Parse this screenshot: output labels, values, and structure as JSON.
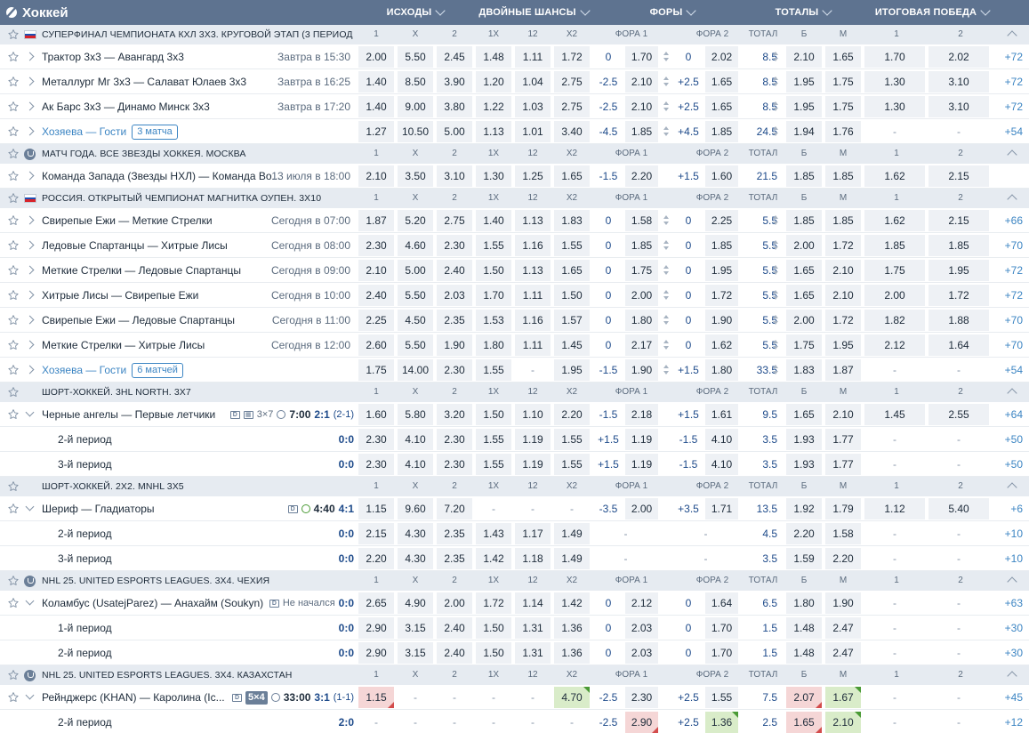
{
  "header": {
    "title": "Хоккей",
    "columns": [
      "ИСХОДЫ",
      "ДВОЙНЫЕ ШАНСЫ",
      "ФОРЫ",
      "ТОТАЛЫ",
      "ИТОГОВАЯ ПОБЕДА"
    ]
  },
  "market_labels": [
    "1",
    "X",
    "2",
    "1X",
    "12",
    "X2",
    "ФОРА 1",
    "ФОРА 2",
    "ТОТАЛ",
    "Б",
    "М",
    "1",
    "2"
  ],
  "rows": [
    {
      "type": "group",
      "flag": "ru",
      "name": "СУПЕРФИНАЛ ЧЕМПИОНАТА КХЛ 3Х3. КРУГОВОЙ ЭТАП (3 ПЕРИОД..."
    },
    {
      "type": "event",
      "name": "Трактор 3х3 — Авангард 3х3",
      "time": "Завтра в 15:30",
      "odds": [
        "2.00",
        "5.50",
        "2.45",
        "1.48",
        "1.11",
        "1.72"
      ],
      "h1": "0",
      "h1o": "1.70",
      "h2": "0",
      "h2o": "2.02",
      "total": "8.5",
      "ov": "2.10",
      "un": "1.65",
      "w1": "1.70",
      "w2": "2.02",
      "more": "+72",
      "spin": true
    },
    {
      "type": "event",
      "name": "Металлург Мг 3х3 — Салават Юлаев 3х3",
      "time": "Завтра в 16:25",
      "odds": [
        "1.40",
        "8.50",
        "3.90",
        "1.20",
        "1.04",
        "2.75"
      ],
      "h1": "-2.5",
      "h1o": "2.10",
      "h2": "+2.5",
      "h2o": "1.65",
      "total": "8.5",
      "ov": "1.95",
      "un": "1.75",
      "w1": "1.30",
      "w2": "3.10",
      "more": "+72",
      "spin": true
    },
    {
      "type": "event",
      "name": "Ак Барс 3х3 — Динамо Минск 3х3",
      "time": "Завтра в 17:20",
      "odds": [
        "1.40",
        "9.00",
        "3.80",
        "1.22",
        "1.03",
        "2.75"
      ],
      "h1": "-2.5",
      "h1o": "2.10",
      "h2": "+2.5",
      "h2o": "1.65",
      "total": "8.5",
      "ov": "1.95",
      "un": "1.75",
      "w1": "1.30",
      "w2": "3.10",
      "more": "+72",
      "spin": true
    },
    {
      "type": "event",
      "name": "Хозяева — Гости",
      "link": true,
      "badge": "3 матча",
      "odds": [
        "1.27",
        "10.50",
        "5.00",
        "1.13",
        "1.01",
        "3.40"
      ],
      "h1": "-4.5",
      "h1o": "1.85",
      "h2": "+4.5",
      "h2o": "1.85",
      "total": "24.5",
      "ov": "1.94",
      "un": "1.76",
      "w1": "-",
      "w2": "-",
      "more": "+54",
      "spin": true
    },
    {
      "type": "group",
      "flag": "cup",
      "name": "МАТЧ ГОДА. ВСЕ ЗВЕЗДЫ ХОККЕЯ. МОСКВА"
    },
    {
      "type": "event",
      "name": "Команда Запада (Звезды НХЛ) — Команда Во...",
      "time": "13 июля в 18:00",
      "odds": [
        "2.10",
        "3.50",
        "3.10",
        "1.30",
        "1.25",
        "1.65"
      ],
      "h1": "-1.5",
      "h1o": "2.20",
      "h2": "+1.5",
      "h2o": "1.60",
      "total": "21.5",
      "ov": "1.85",
      "un": "1.85",
      "w1": "1.62",
      "w2": "2.15",
      "more": ""
    },
    {
      "type": "group",
      "flag": "ru",
      "name": "РОССИЯ. ОТКРЫТЫЙ ЧЕМПИОНАТ МАГНИТКА ОУПЕН. 3Х10"
    },
    {
      "type": "event",
      "name": "Свирепые Ежи — Меткие Стрелки",
      "time": "Сегодня в 07:00",
      "odds": [
        "1.87",
        "5.20",
        "2.75",
        "1.40",
        "1.13",
        "1.83"
      ],
      "h1": "0",
      "h1o": "1.58",
      "h2": "0",
      "h2o": "2.25",
      "total": "5.5",
      "ov": "1.85",
      "un": "1.85",
      "w1": "1.62",
      "w2": "2.15",
      "more": "+66",
      "spin": true
    },
    {
      "type": "event",
      "name": "Ледовые Спартанцы — Хитрые Лисы",
      "time": "Сегодня в 08:00",
      "odds": [
        "2.30",
        "4.60",
        "2.30",
        "1.55",
        "1.16",
        "1.55"
      ],
      "h1": "0",
      "h1o": "1.85",
      "h2": "0",
      "h2o": "1.85",
      "total": "5.5",
      "ov": "2.00",
      "un": "1.72",
      "w1": "1.85",
      "w2": "1.85",
      "more": "+70",
      "spin": true
    },
    {
      "type": "event",
      "name": "Меткие Стрелки — Ледовые Спартанцы",
      "time": "Сегодня в 09:00",
      "odds": [
        "2.10",
        "5.00",
        "2.40",
        "1.50",
        "1.13",
        "1.65"
      ],
      "h1": "0",
      "h1o": "1.75",
      "h2": "0",
      "h2o": "1.95",
      "total": "5.5",
      "ov": "1.65",
      "un": "2.10",
      "w1": "1.75",
      "w2": "1.95",
      "more": "+72",
      "spin": true
    },
    {
      "type": "event",
      "name": "Хитрые Лисы — Свирепые Ежи",
      "time": "Сегодня в 10:00",
      "odds": [
        "2.40",
        "5.50",
        "2.03",
        "1.70",
        "1.11",
        "1.50"
      ],
      "h1": "0",
      "h1o": "2.00",
      "h2": "0",
      "h2o": "1.72",
      "total": "5.5",
      "ov": "1.65",
      "un": "2.10",
      "w1": "2.00",
      "w2": "1.72",
      "more": "+72",
      "spin": true
    },
    {
      "type": "event",
      "name": "Свирепые Ежи — Ледовые Спартанцы",
      "time": "Сегодня в 11:00",
      "odds": [
        "2.25",
        "4.50",
        "2.35",
        "1.53",
        "1.16",
        "1.57"
      ],
      "h1": "0",
      "h1o": "1.80",
      "h2": "0",
      "h2o": "1.90",
      "total": "5.5",
      "ov": "2.00",
      "un": "1.72",
      "w1": "1.82",
      "w2": "1.88",
      "more": "+70",
      "spin": true
    },
    {
      "type": "event",
      "name": "Меткие Стрелки — Хитрые Лисы",
      "time": "Сегодня в 12:00",
      "odds": [
        "2.60",
        "5.50",
        "1.90",
        "1.80",
        "1.11",
        "1.45"
      ],
      "h1": "0",
      "h1o": "2.17",
      "h2": "0",
      "h2o": "1.62",
      "total": "5.5",
      "ov": "1.75",
      "un": "1.95",
      "w1": "2.12",
      "w2": "1.64",
      "more": "+70",
      "spin": true
    },
    {
      "type": "event",
      "name": "Хозяева — Гости",
      "link": true,
      "badge": "6 матчей",
      "odds": [
        "1.75",
        "14.00",
        "2.30",
        "1.55",
        "-",
        "1.95"
      ],
      "h1": "-1.5",
      "h1o": "1.90",
      "h2": "+1.5",
      "h2o": "1.80",
      "total": "33.5",
      "ov": "1.83",
      "un": "1.87",
      "w1": "-",
      "w2": "-",
      "more": "+54",
      "spin": true
    },
    {
      "type": "group",
      "flag": "none",
      "name": "ШОРТ-ХОККЕЙ. 3HL NORTH. 3X7"
    },
    {
      "type": "live",
      "name": "Черные ангелы — Первые летчики",
      "fmt": "3×7",
      "clock": "7:00",
      "score": "2:1",
      "sub": "(2-1)",
      "icons": [
        "D",
        "▦"
      ],
      "odds": [
        "1.60",
        "5.80",
        "3.20",
        "1.50",
        "1.10",
        "2.20"
      ],
      "h1": "-1.5",
      "h1o": "2.18",
      "h2": "+1.5",
      "h2o": "1.61",
      "total": "9.5",
      "ov": "1.65",
      "un": "2.10",
      "w1": "1.45",
      "w2": "2.55",
      "more": "+64"
    },
    {
      "type": "sub",
      "name": "2-й период",
      "score": "0:0",
      "odds": [
        "2.30",
        "4.10",
        "2.30",
        "1.55",
        "1.19",
        "1.55"
      ],
      "h1": "+1.5",
      "h1o": "1.19",
      "h2": "-1.5",
      "h2o": "4.10",
      "total": "3.5",
      "ov": "1.93",
      "un": "1.77",
      "w1": "-",
      "w2": "-",
      "more": "+50"
    },
    {
      "type": "sub",
      "name": "3-й период",
      "score": "0:0",
      "odds": [
        "2.30",
        "4.10",
        "2.30",
        "1.55",
        "1.19",
        "1.55"
      ],
      "h1": "+1.5",
      "h1o": "1.19",
      "h2": "-1.5",
      "h2o": "4.10",
      "total": "3.5",
      "ov": "1.93",
      "un": "1.77",
      "w1": "-",
      "w2": "-",
      "more": "+50"
    },
    {
      "type": "group",
      "flag": "none",
      "name": "ШОРТ-ХОККЕЙ. 2X2. MNHL 3X5"
    },
    {
      "type": "live",
      "name": "Шериф — Гладиаторы",
      "clock": "4:40",
      "score": "4:1",
      "icons": [
        "D"
      ],
      "greenclock": true,
      "odds": [
        "1.15",
        "9.60",
        "7.20",
        "-",
        "-",
        "-"
      ],
      "h1": "-3.5",
      "h1o": "2.00",
      "h2": "+3.5",
      "h2o": "1.71",
      "total": "13.5",
      "ov": "1.92",
      "un": "1.79",
      "w1": "1.12",
      "w2": "5.40",
      "more": "+6"
    },
    {
      "type": "sub",
      "name": "2-й период",
      "score": "0:0",
      "odds": [
        "2.15",
        "4.30",
        "2.35",
        "1.43",
        "1.17",
        "1.49"
      ],
      "h1": "",
      "h1o": "-",
      "h2": "",
      "h2o": "-",
      "total": "4.5",
      "ov": "2.20",
      "un": "1.58",
      "w1": "-",
      "w2": "-",
      "more": "+10"
    },
    {
      "type": "sub",
      "name": "3-й период",
      "score": "0:0",
      "odds": [
        "2.20",
        "4.30",
        "2.35",
        "1.42",
        "1.18",
        "1.49"
      ],
      "h1": "",
      "h1o": "-",
      "h2": "",
      "h2o": "-",
      "total": "3.5",
      "ov": "1.59",
      "un": "2.20",
      "w1": "-",
      "w2": "-",
      "more": "+10"
    },
    {
      "type": "group",
      "flag": "cup",
      "name": "NHL 25. UNITED ESPORTS LEAGUES. 3Х4. ЧЕХИЯ"
    },
    {
      "type": "live",
      "name": "Коламбус (UsatejParez) — Анахайм (Soukyn)",
      "status": "Не начался",
      "score": "0:0",
      "icons": [
        "D"
      ],
      "odds": [
        "2.65",
        "4.90",
        "2.00",
        "1.72",
        "1.14",
        "1.42"
      ],
      "h1": "0",
      "h1o": "2.12",
      "h2": "0",
      "h2o": "1.64",
      "total": "6.5",
      "ov": "1.80",
      "un": "1.90",
      "w1": "-",
      "w2": "-",
      "more": "+63"
    },
    {
      "type": "sub",
      "name": "1-й период",
      "score": "0:0",
      "odds": [
        "2.90",
        "3.15",
        "2.40",
        "1.50",
        "1.31",
        "1.36"
      ],
      "h1": "0",
      "h1o": "2.03",
      "h2": "0",
      "h2o": "1.70",
      "total": "1.5",
      "ov": "1.48",
      "un": "2.47",
      "w1": "-",
      "w2": "-",
      "more": "+30"
    },
    {
      "type": "sub",
      "name": "2-й период",
      "score": "0:0",
      "odds": [
        "2.90",
        "3.15",
        "2.40",
        "1.50",
        "1.31",
        "1.36"
      ],
      "h1": "0",
      "h1o": "2.03",
      "h2": "0",
      "h2o": "1.70",
      "total": "1.5",
      "ov": "1.48",
      "un": "2.47",
      "w1": "-",
      "w2": "-",
      "more": "+30"
    },
    {
      "type": "group",
      "flag": "cup",
      "name": "NHL 25. UNITED ESPORTS LEAGUES. 3Х4. КАЗАХСТАН"
    },
    {
      "type": "live",
      "name": "Рейнджерс (KHAN) — Каролина (Ic...",
      "fmtBadge": "5×4",
      "clock": "33:00",
      "score": "3:1",
      "sub": "(1-1)",
      "icons": [
        "D"
      ],
      "odds": [
        "1.15",
        "-",
        "-",
        "-",
        "-",
        "4.70"
      ],
      "dn": [
        0
      ],
      "up": [
        5
      ],
      "h1": "-2.5",
      "h1o": "2.30",
      "h2": "+2.5",
      "h2o": "1.55",
      "total": "7.5",
      "ov": "2.07",
      "un": "1.67",
      "ovdn": true,
      "unup": true,
      "w1": "-",
      "w2": "-",
      "more": "+45"
    },
    {
      "type": "sub",
      "name": "2-й период",
      "score": "2:0",
      "odds": [
        "-",
        "-",
        "-",
        "-",
        "-",
        "-"
      ],
      "h1": "-2.5",
      "h1o": "2.90",
      "h1dn": true,
      "h2": "+2.5",
      "h2o": "1.36",
      "h2up": true,
      "total": "2.5",
      "ov": "1.65",
      "un": "2.10",
      "ovdn": true,
      "unup": true,
      "w1": "-",
      "w2": "-",
      "more": "+12"
    }
  ]
}
